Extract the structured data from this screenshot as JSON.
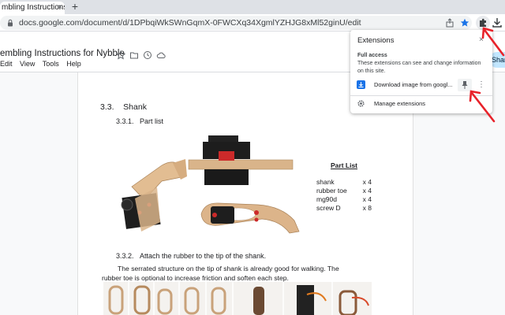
{
  "browser": {
    "tab_title": "mbling Instructions for Nybble",
    "tab_close": "×",
    "new_tab": "+",
    "url": "docs.google.com/document/d/1DPbqiWkSWnGqmX-0FWCXq34XgmlYZHJG8xMl52ginU/edit"
  },
  "doc": {
    "title": "embling Instructions for Nybble",
    "menu": [
      "Edit",
      "View",
      "Tools",
      "Help"
    ],
    "share_label": "Share"
  },
  "content": {
    "section_title": "3.3.    Shank",
    "sub1": "3.3.1.   Part list",
    "part_list_title": "Part List",
    "parts": [
      {
        "name": "shank",
        "qty": "x 4"
      },
      {
        "name": "rubber toe",
        "qty": "x 4"
      },
      {
        "name": "mg90d",
        "qty": "x 4"
      },
      {
        "name": "screw D",
        "qty": "x 8"
      }
    ],
    "sub2": "3.3.2.   Attach the rubber to the tip of the shank.",
    "para_line1": "The serrated structure on the tip of shank is already good for walking. The",
    "para_line2": "rubber toe is optional to increase friction and soften each step."
  },
  "extensions_popup": {
    "title": "Extensions",
    "close": "×",
    "access_heading": "Full access",
    "access_desc": "These extensions can see and change information on this site.",
    "item_name": "Download image from googl...",
    "more": "⋮",
    "manage_label": "Manage extensions"
  },
  "colors": {
    "accent_arrow": "#e8222a",
    "chrome_blue": "#1a73e8",
    "wood": "#d9b48a",
    "servo": "#222222"
  }
}
